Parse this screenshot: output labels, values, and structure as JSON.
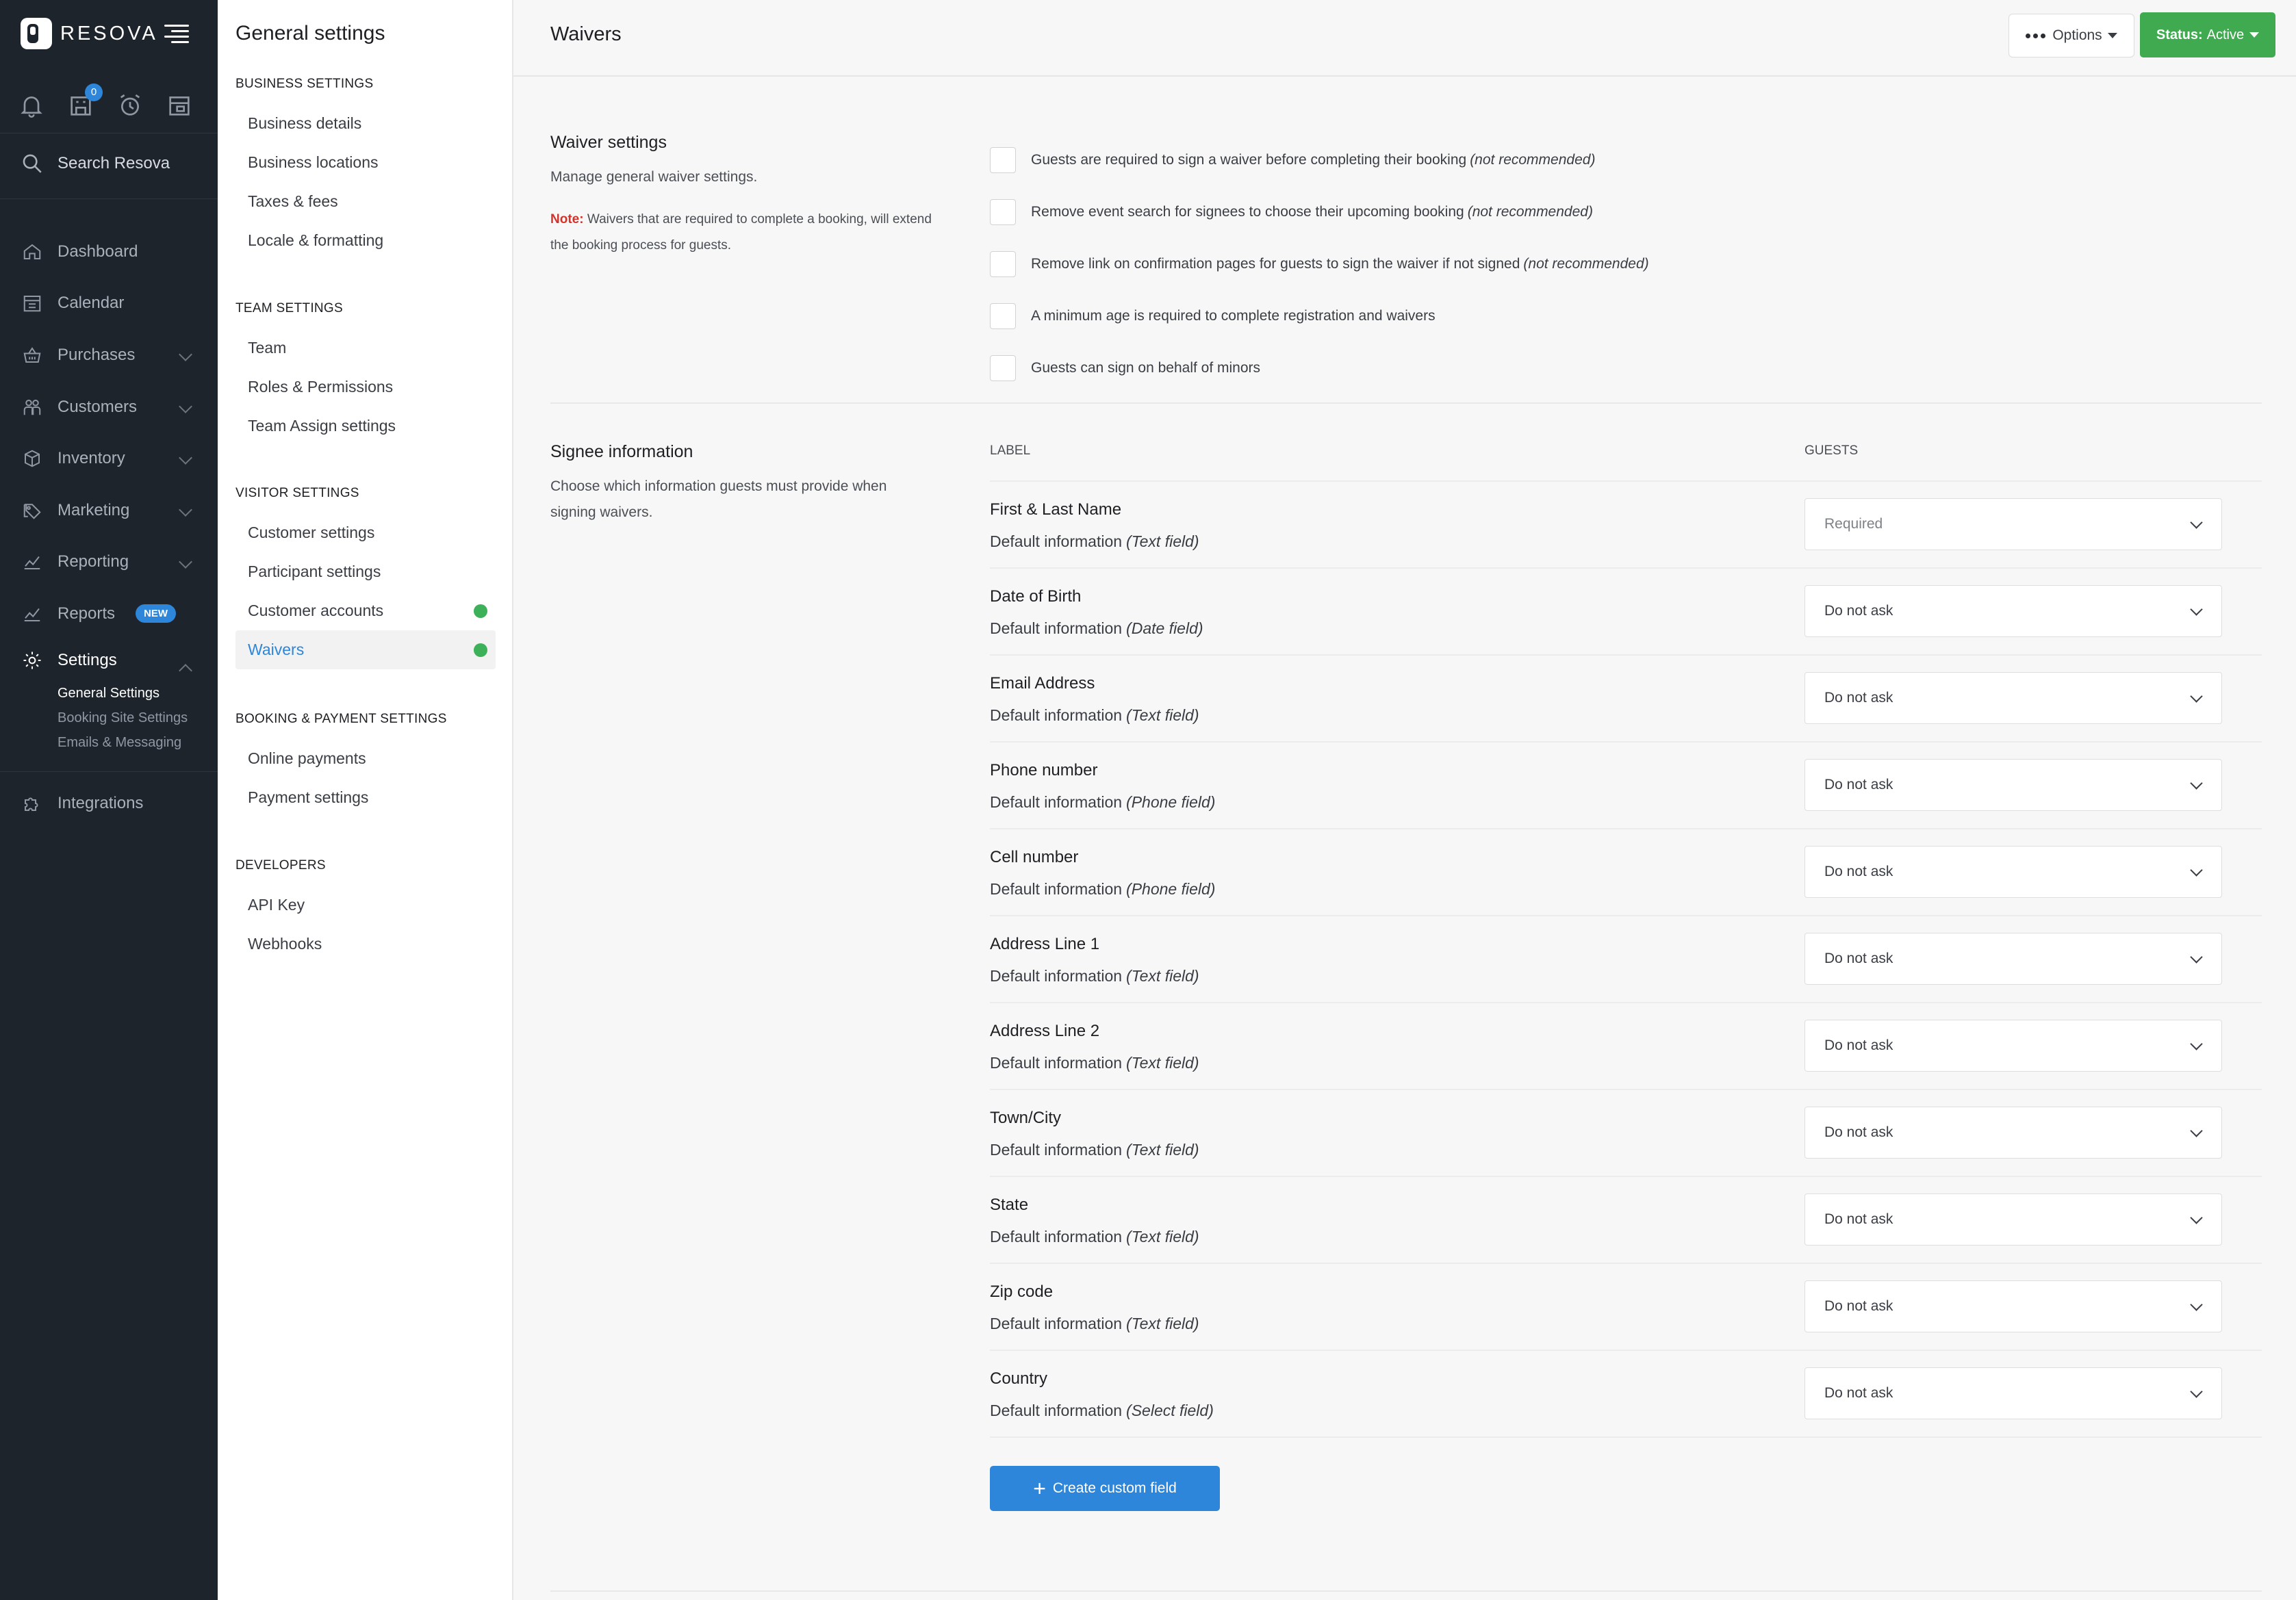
{
  "brand": {
    "name": "RESOVA"
  },
  "nav": {
    "notification_badge": "0",
    "search_label": "Search Resova",
    "items": [
      {
        "label": "Dashboard",
        "icon": "home-icon"
      },
      {
        "label": "Calendar",
        "icon": "calendar-icon"
      },
      {
        "label": "Purchases",
        "icon": "basket-icon"
      },
      {
        "label": "Customers",
        "icon": "customers-icon"
      },
      {
        "label": "Inventory",
        "icon": "box-icon"
      },
      {
        "label": "Marketing",
        "icon": "tag-icon"
      },
      {
        "label": "Reporting",
        "icon": "chart-icon"
      },
      {
        "label": "Reports",
        "icon": "chart-icon",
        "badge": "NEW"
      },
      {
        "label": "Settings",
        "icon": "gear-icon"
      },
      {
        "label": "Integrations",
        "icon": "puzzle-icon"
      }
    ],
    "settings_sub": [
      "General Settings",
      "Booking Site Settings",
      "Emails & Messaging"
    ]
  },
  "settings_panel": {
    "title": "General settings",
    "groups": [
      {
        "heading": "BUSINESS SETTINGS",
        "items": [
          "Business details",
          "Business locations",
          "Taxes & fees",
          "Locale & formatting"
        ]
      },
      {
        "heading": "TEAM SETTINGS",
        "items": [
          "Team",
          "Roles & Permissions",
          "Team Assign settings"
        ]
      },
      {
        "heading": "VISITOR SETTINGS",
        "items": [
          "Customer settings",
          "Participant settings",
          "Customer accounts",
          "Waivers"
        ]
      },
      {
        "heading": "BOOKING & PAYMENT SETTINGS",
        "items": [
          "Online payments",
          "Payment settings"
        ]
      },
      {
        "heading": "DEVELOPERS",
        "items": [
          "API Key",
          "Webhooks"
        ]
      }
    ]
  },
  "header": {
    "title": "Waivers",
    "options_label": "Options",
    "status_prefix": "Status:",
    "status_value": "Active"
  },
  "waiver_settings": {
    "title": "Waiver settings",
    "description": "Manage general waiver settings.",
    "note_label": "Note:",
    "note_text": "Waivers that are required to complete a booking, will extend the booking process for guests.",
    "options": [
      {
        "text": "Guests are required to sign a waiver before completing their booking",
        "hint": "(not recommended)"
      },
      {
        "text": "Remove event search for signees to choose their upcoming booking",
        "hint": "(not recommended)"
      },
      {
        "text": "Remove link on confirmation pages for guests to sign the waiver if not signed",
        "hint": "(not recommended)"
      },
      {
        "text": "A minimum age is required to complete registration and waivers",
        "hint": ""
      },
      {
        "text": "Guests can sign on behalf of minors",
        "hint": ""
      }
    ]
  },
  "signee_info": {
    "title": "Signee information",
    "description": "Choose which information guests must provide when signing waivers.",
    "col_label": "LABEL",
    "col_guests": "GUESTS",
    "fields": [
      {
        "name": "First & Last Name",
        "source": "Default information",
        "type": "(Text field)",
        "value": "Required"
      },
      {
        "name": "Date of Birth",
        "source": "Default information",
        "type": "(Date field)",
        "value": "Do not ask"
      },
      {
        "name": "Email Address",
        "source": "Default information",
        "type": "(Text field)",
        "value": "Do not ask"
      },
      {
        "name": "Phone number",
        "source": "Default information",
        "type": "(Phone field)",
        "value": "Do not ask"
      },
      {
        "name": "Cell number",
        "source": "Default information",
        "type": "(Phone field)",
        "value": "Do not ask"
      },
      {
        "name": "Address Line 1",
        "source": "Default information",
        "type": "(Text field)",
        "value": "Do not ask"
      },
      {
        "name": "Address Line 2",
        "source": "Default information",
        "type": "(Text field)",
        "value": "Do not ask"
      },
      {
        "name": "Town/City",
        "source": "Default information",
        "type": "(Text field)",
        "value": "Do not ask"
      },
      {
        "name": "State",
        "source": "Default information",
        "type": "(Text field)",
        "value": "Do not ask"
      },
      {
        "name": "Zip code",
        "source": "Default information",
        "type": "(Text field)",
        "value": "Do not ask"
      },
      {
        "name": "Country",
        "source": "Default information",
        "type": "(Select field)",
        "value": "Do not ask"
      }
    ],
    "create_button": "Create custom field"
  },
  "colors": {
    "accent": "#2d86d9",
    "success": "#3faa4f",
    "nav_bg": "#1e242c",
    "note_red": "#d0342c"
  }
}
